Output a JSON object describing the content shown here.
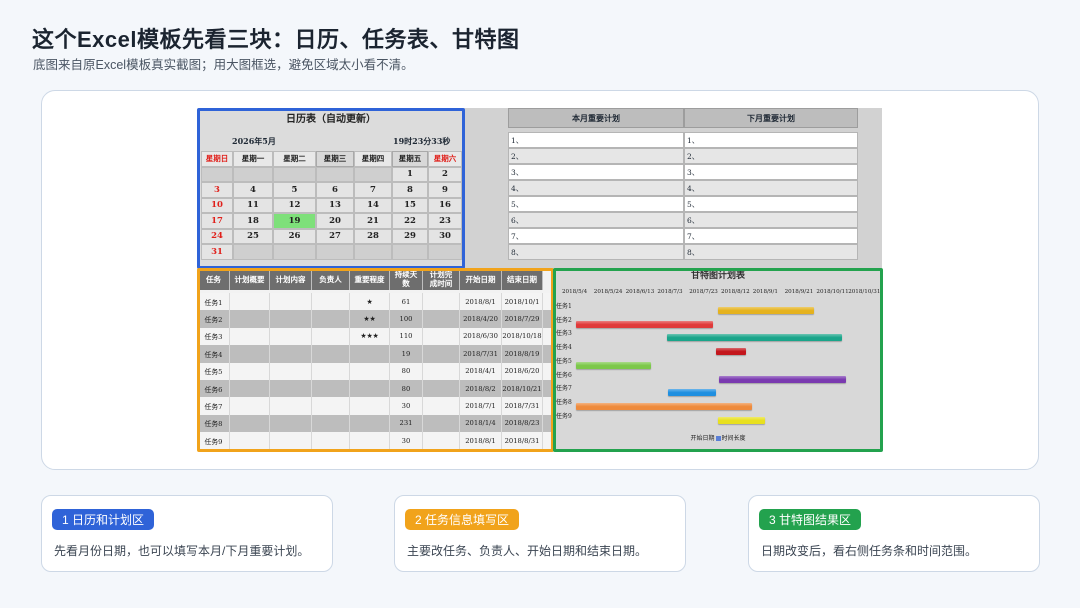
{
  "header": {
    "title": "这个Excel模板先看三块：日历、任务表、甘特图",
    "subtitle": "底图来自原Excel模板真实截图；用大图框选，避免区域太小看不清。"
  },
  "calendar": {
    "title": "日历表（自动更新）",
    "month": "2026年5月",
    "time": "19时23分33秒",
    "weekdays": [
      "星期日",
      "星期一",
      "星期二",
      "星期三",
      "星期四",
      "星期五",
      "星期六"
    ],
    "weeks": [
      [
        "",
        "",
        "",
        "",
        "",
        "1",
        "2"
      ],
      [
        "3",
        "4",
        "5",
        "6",
        "7",
        "8",
        "9"
      ],
      [
        "10",
        "11",
        "12",
        "13",
        "14",
        "15",
        "16"
      ],
      [
        "17",
        "18",
        "19",
        "20",
        "21",
        "22",
        "23"
      ],
      [
        "24",
        "25",
        "26",
        "27",
        "28",
        "29",
        "30"
      ],
      [
        "31",
        "",
        "",
        "",
        "",
        "",
        ""
      ]
    ],
    "today": "19"
  },
  "plans": {
    "this_month_header": "本月重要计划",
    "next_month_header": "下月重要计划",
    "rows": [
      "1、",
      "2、",
      "3、",
      "4、",
      "5、",
      "6、",
      "7、",
      "8、"
    ]
  },
  "task_table": {
    "headers": [
      "任务",
      "计划概要",
      "计划内容",
      "负责人",
      "重要程度",
      "持续天数",
      "计划完成时间",
      "开始日期",
      "结束日期"
    ],
    "header_display": [
      "任务",
      "计划概要",
      "计划内容",
      "负责人",
      "重要程度",
      "持续天\n数",
      "计划完\n成时间",
      "开始日期",
      "结束日期"
    ],
    "rows": [
      {
        "task": "任务1",
        "importance": "★",
        "days": "61",
        "start": "2018/8/1",
        "end": "2018/10/1"
      },
      {
        "task": "任务2",
        "importance": "★★",
        "days": "100",
        "start": "2018/4/20",
        "end": "2018/7/29"
      },
      {
        "task": "任务3",
        "importance": "★★★",
        "days": "110",
        "start": "2018/6/30",
        "end": "2018/10/18"
      },
      {
        "task": "任务4",
        "importance": "",
        "days": "19",
        "start": "2018/7/31",
        "end": "2018/8/19"
      },
      {
        "task": "任务5",
        "importance": "",
        "days": "80",
        "start": "2018/4/1",
        "end": "2018/6/20"
      },
      {
        "task": "任务6",
        "importance": "",
        "days": "80",
        "start": "2018/8/2",
        "end": "2018/10/21"
      },
      {
        "task": "任务7",
        "importance": "",
        "days": "30",
        "start": "2018/7/1",
        "end": "2018/7/31"
      },
      {
        "task": "任务8",
        "importance": "",
        "days": "231",
        "start": "2018/1/4",
        "end": "2018/8/23"
      },
      {
        "task": "任务9",
        "importance": "",
        "days": "30",
        "start": "2018/8/1",
        "end": "2018/8/31"
      }
    ]
  },
  "gantt": {
    "title": "甘特图计划表",
    "date_ticks": [
      "2018/5/4",
      "2018/5/24",
      "2018/6/13",
      "2018/7/3",
      "2018/7/23",
      "2018/8/12",
      "2018/9/1",
      "2018/9/21",
      "2018/10/11",
      "2018/10/31"
    ],
    "legend_start": "开始日期",
    "legend_duration": "时间长度",
    "legend_color": "#5a7fd6",
    "bars": [
      {
        "task": "任务1",
        "start": "2018/8/1",
        "end": "2018/10/1",
        "color": "#e5b21e"
      },
      {
        "task": "任务2",
        "start": "2018/4/20",
        "end": "2018/7/29",
        "color": "#e03a3a"
      },
      {
        "task": "任务3",
        "start": "2018/6/30",
        "end": "2018/10/18",
        "color": "#1aa58a"
      },
      {
        "task": "任务4",
        "start": "2018/7/31",
        "end": "2018/8/19",
        "color": "#c4161c"
      },
      {
        "task": "任务5",
        "start": "2018/4/1",
        "end": "2018/6/20",
        "color": "#7cc84a"
      },
      {
        "task": "任务6",
        "start": "2018/8/2",
        "end": "2018/10/21",
        "color": "#7a3ab0"
      },
      {
        "task": "任务7",
        "start": "2018/7/1",
        "end": "2018/7/31",
        "color": "#1f8fe0"
      },
      {
        "task": "任务8",
        "start": "2018/1/4",
        "end": "2018/8/23",
        "color": "#ee8a3c"
      },
      {
        "task": "任务9",
        "start": "2018/8/1",
        "end": "2018/8/31",
        "color": "#e8e01e"
      }
    ]
  },
  "cards": [
    {
      "badge": "1 日历和计划区",
      "text": "先看月份日期，也可以填写本月/下月重要计划。",
      "color": "#2f63d8"
    },
    {
      "badge": "2 任务信息填写区",
      "text": "主要改任务、负责人、开始日期和结束日期。",
      "color": "#f1a31b"
    },
    {
      "badge": "3 甘特图结果区",
      "text": "日期改变后，看右侧任务条和时间范围。",
      "color": "#23a24e"
    }
  ]
}
